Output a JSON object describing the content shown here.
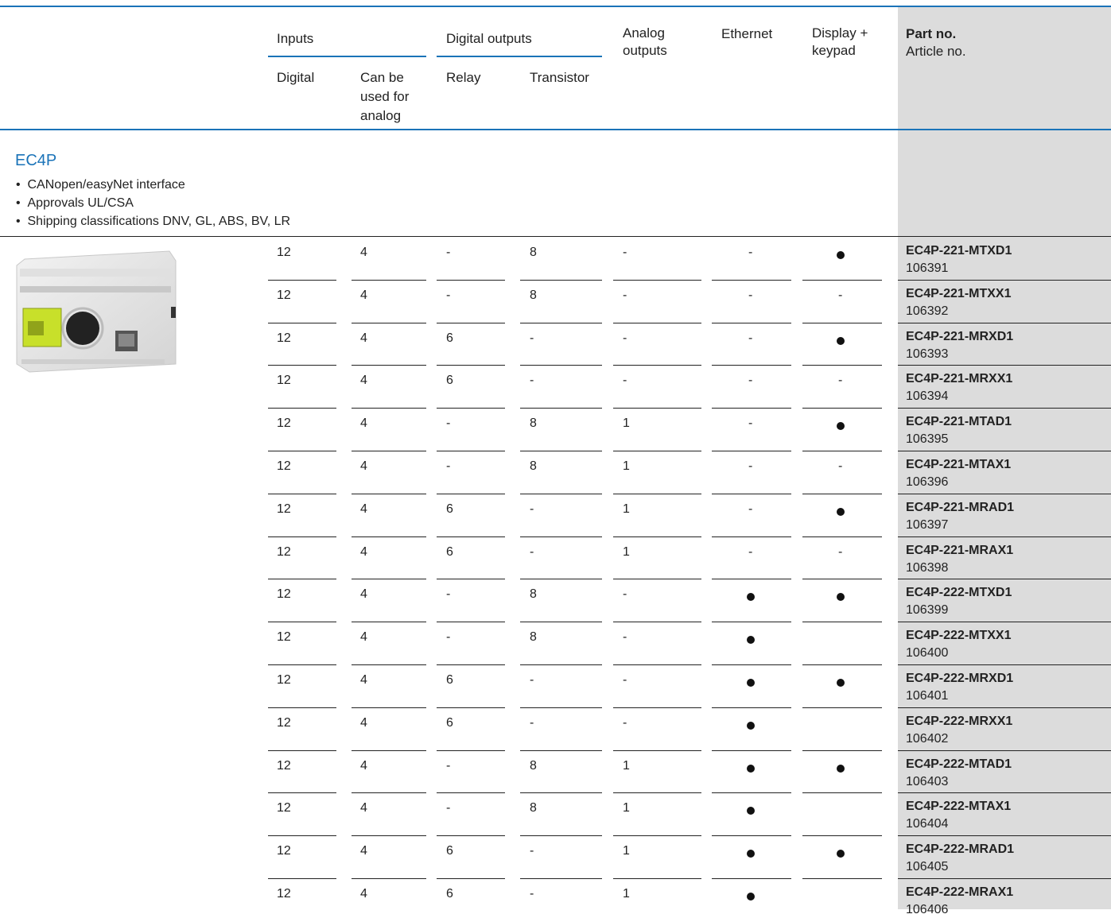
{
  "header": {
    "inputs": "Inputs",
    "digital_outputs": "Digital outputs",
    "analog_outputs": "Analog\noutputs",
    "ethernet": "Ethernet",
    "display_keypad": "Display +\nkeypad",
    "part_no": "Part no.",
    "article_no": "Article no.",
    "sub_digital": "Digital",
    "sub_analog": "Can be\nused for\nanalog",
    "sub_relay": "Relay",
    "sub_transistor": "Transistor"
  },
  "section": {
    "title": "EC4P",
    "bullets": [
      "CANopen/easyNet interface",
      "Approvals UL/CSA",
      "Shipping classifications DNV, GL, ABS, BV, LR"
    ]
  },
  "rows": [
    {
      "digital": "12",
      "analog_in": "4",
      "relay": "-",
      "transistor": "8",
      "analog_out": "-",
      "ethernet": "-",
      "display": "●",
      "part": "EC4P-221-MTXD1",
      "article": "106391"
    },
    {
      "digital": "12",
      "analog_in": "4",
      "relay": "-",
      "transistor": "8",
      "analog_out": "-",
      "ethernet": "-",
      "display": "-",
      "part": "EC4P-221-MTXX1",
      "article": "106392"
    },
    {
      "digital": "12",
      "analog_in": "4",
      "relay": "6",
      "transistor": "-",
      "analog_out": "-",
      "ethernet": "-",
      "display": "●",
      "part": "EC4P-221-MRXD1",
      "article": "106393"
    },
    {
      "digital": "12",
      "analog_in": "4",
      "relay": "6",
      "transistor": "-",
      "analog_out": "-",
      "ethernet": "-",
      "display": "-",
      "part": "EC4P-221-MRXX1",
      "article": "106394"
    },
    {
      "digital": "12",
      "analog_in": "4",
      "relay": "-",
      "transistor": "8",
      "analog_out": "1",
      "ethernet": "-",
      "display": "●",
      "part": "EC4P-221-MTAD1",
      "article": "106395"
    },
    {
      "digital": "12",
      "analog_in": "4",
      "relay": "-",
      "transistor": "8",
      "analog_out": "1",
      "ethernet": "-",
      "display": "-",
      "part": "EC4P-221-MTAX1",
      "article": "106396"
    },
    {
      "digital": "12",
      "analog_in": "4",
      "relay": "6",
      "transistor": "-",
      "analog_out": "1",
      "ethernet": "-",
      "display": "●",
      "part": "EC4P-221-MRAD1",
      "article": "106397"
    },
    {
      "digital": "12",
      "analog_in": "4",
      "relay": "6",
      "transistor": "-",
      "analog_out": "1",
      "ethernet": "-",
      "display": "-",
      "part": "EC4P-221-MRAX1",
      "article": "106398"
    },
    {
      "digital": "12",
      "analog_in": "4",
      "relay": "-",
      "transistor": "8",
      "analog_out": "-",
      "ethernet": "●",
      "display": "●",
      "part": "EC4P-222-MTXD1",
      "article": "106399"
    },
    {
      "digital": "12",
      "analog_in": "4",
      "relay": "-",
      "transistor": "8",
      "analog_out": "-",
      "ethernet": "●",
      "display": "",
      "part": "EC4P-222-MTXX1",
      "article": "106400"
    },
    {
      "digital": "12",
      "analog_in": "4",
      "relay": "6",
      "transistor": "-",
      "analog_out": "-",
      "ethernet": "●",
      "display": "●",
      "part": "EC4P-222-MRXD1",
      "article": "106401"
    },
    {
      "digital": "12",
      "analog_in": "4",
      "relay": "6",
      "transistor": "-",
      "analog_out": "-",
      "ethernet": "●",
      "display": "",
      "part": "EC4P-222-MRXX1",
      "article": "106402"
    },
    {
      "digital": "12",
      "analog_in": "4",
      "relay": "-",
      "transistor": "8",
      "analog_out": "1",
      "ethernet": "●",
      "display": "●",
      "part": "EC4P-222-MTAD1",
      "article": "106403"
    },
    {
      "digital": "12",
      "analog_in": "4",
      "relay": "-",
      "transistor": "8",
      "analog_out": "1",
      "ethernet": "●",
      "display": "",
      "part": "EC4P-222-MTAX1",
      "article": "106404"
    },
    {
      "digital": "12",
      "analog_in": "4",
      "relay": "6",
      "transistor": "-",
      "analog_out": "1",
      "ethernet": "●",
      "display": "●",
      "part": "EC4P-222-MRAD1",
      "article": "106405"
    },
    {
      "digital": "12",
      "analog_in": "4",
      "relay": "6",
      "transistor": "-",
      "analog_out": "1",
      "ethernet": "●",
      "display": "",
      "part": "EC4P-222-MRAX1",
      "article": "106406"
    }
  ]
}
